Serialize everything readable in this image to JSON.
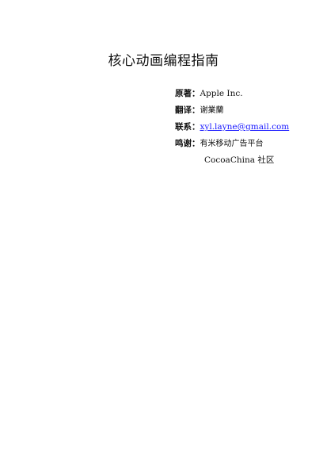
{
  "document": {
    "title": "核心动画编程指南",
    "credits": {
      "original": {
        "label": "原著：",
        "value": "Apple Inc."
      },
      "translator": {
        "label": "翻译：",
        "value": "谢業蘭"
      },
      "contact": {
        "label": "联系：",
        "value": "xyl.layne@gmail.com"
      },
      "thanks": {
        "label": "鸣谢：",
        "value": "有米移动广告平台",
        "value_2": "CocoaChina  社区"
      }
    }
  },
  "colors": {
    "text": "#111111",
    "link": "#1a1aff",
    "background": "#ffffff"
  }
}
